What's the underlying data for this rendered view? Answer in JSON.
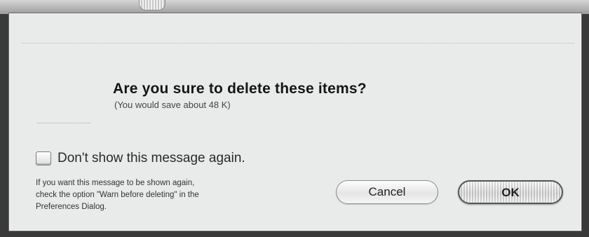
{
  "dialog": {
    "message": "Are you sure to delete these items?",
    "sub_message": "(You would save about 48 K)",
    "checkbox": {
      "label": "Don't show this message again.",
      "checked": false
    },
    "hint_lines": [
      "If you want this message to be shown again,",
      "check the option \"Warn before deleting\" in the",
      "Preferences Dialog."
    ],
    "buttons": {
      "cancel_label": "Cancel",
      "ok_label": "OK"
    }
  }
}
